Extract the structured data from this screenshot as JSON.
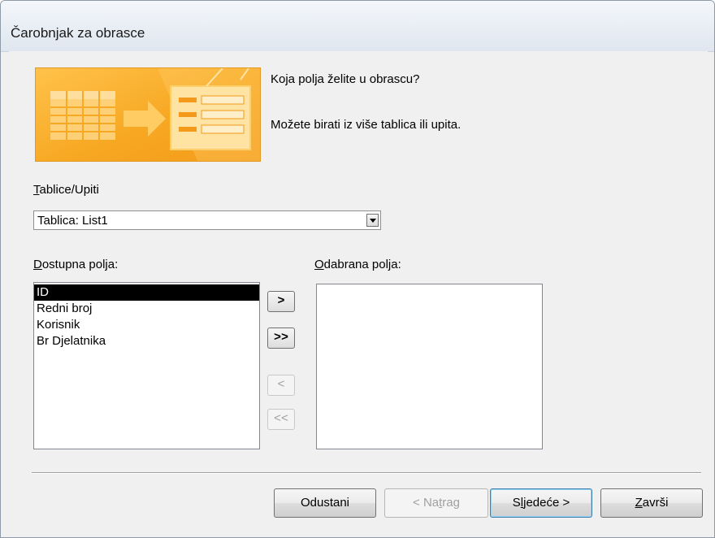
{
  "window": {
    "title": "Čarobnjak za obrasce"
  },
  "intro": {
    "question": "Koja polja želite u obrascu?",
    "hint": "Možete birati iz više tablica ili upita."
  },
  "tables_queries": {
    "label_accel": "T",
    "label_rest": "ablice/Upiti",
    "selected": "Tablica: List1"
  },
  "available_fields": {
    "label_accel": "D",
    "label_rest": "ostupna polja:",
    "items": [
      "ID",
      "Redni broj",
      "Korisnik",
      "Br Djelatnika"
    ],
    "selected_index": 0
  },
  "selected_fields": {
    "label_accel": "O",
    "label_rest": "dabrana polja:",
    "items": []
  },
  "move_buttons": {
    "add_one": ">",
    "add_all": ">>",
    "remove_one": "<",
    "remove_all": "<<"
  },
  "footer": {
    "cancel": "Odustani",
    "back_pre": "< Na",
    "back_accel": "t",
    "back_post": "rag",
    "next_pre": "S",
    "next_accel": "l",
    "next_post": "jedeće >",
    "finish_accel": "Z",
    "finish_post": "avrši"
  },
  "icons": {
    "wizard_banner": "table-to-form-illustration",
    "dropdown": "dropdown-arrow-icon"
  },
  "colors": {
    "banner_orange": "#f7a823",
    "banner_light": "#ffd98a",
    "selection": "#000000",
    "default_button_border": "#3c7fb1"
  }
}
